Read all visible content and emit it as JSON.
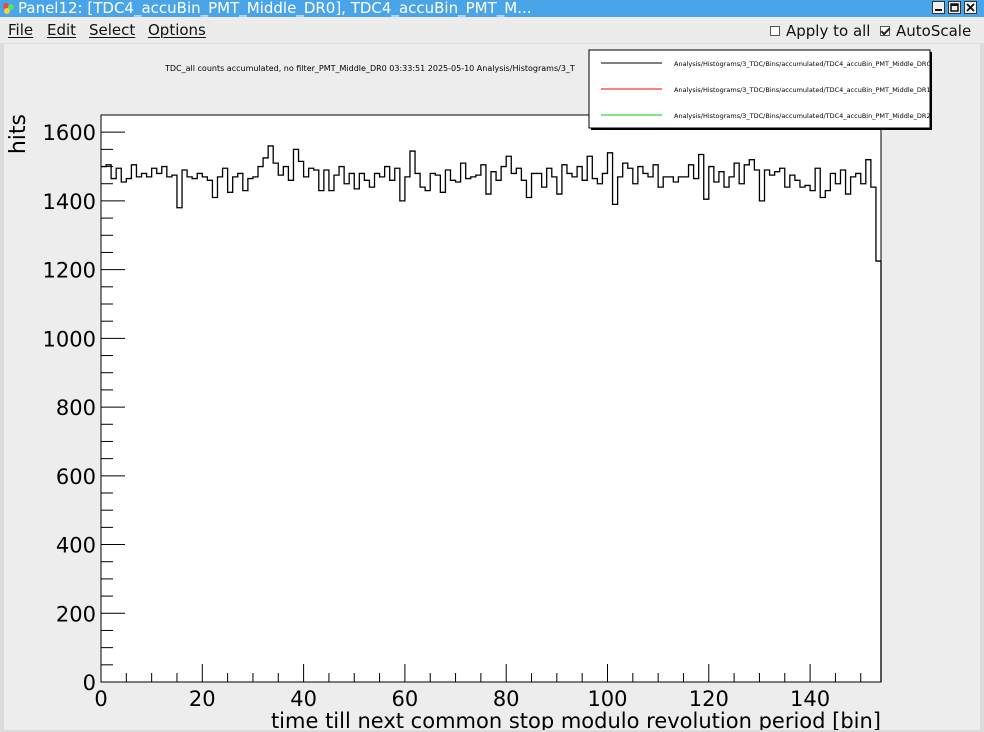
{
  "window": {
    "title": "Panel12: [TDC4_accuBin_PMT_Middle_DR0], TDC4_accuBin_PMT_M..."
  },
  "menu": {
    "file": "File",
    "edit": "Edit",
    "select": "Select",
    "options": "Options"
  },
  "controls": {
    "apply_to_all_label": "Apply to all",
    "apply_to_all_checked": false,
    "autoscale_label": "AutoScale",
    "autoscale_checked": true
  },
  "chart_data": {
    "type": "line",
    "style": "histogram-step",
    "title": "TDC_all counts accumulated, no filter_PMT_Middle_DR0  03:33:51  2025-05-10  Analysis/Histograms/3_T",
    "xlabel": "time till next common stop modulo revolution period [bin]",
    "ylabel": "hits",
    "xlim": [
      0,
      154
    ],
    "ylim": [
      0,
      1650
    ],
    "xticks": [
      0,
      20,
      40,
      60,
      80,
      100,
      120,
      140
    ],
    "yticks": [
      0,
      200,
      400,
      600,
      800,
      1000,
      1200,
      1400,
      1600
    ],
    "grid": false,
    "legend_position": "top-right",
    "series": [
      {
        "name": "Analysis/Histograms/3_TDC/Bins/accumulated/TDC4_accuBin_PMT_Middle_DR0",
        "color": "#000000",
        "bin_width": 1,
        "values": [
          1500,
          1505,
          1465,
          1495,
          1455,
          1465,
          1505,
          1470,
          1480,
          1470,
          1495,
          1480,
          1500,
          1470,
          1475,
          1380,
          1490,
          1470,
          1465,
          1480,
          1470,
          1460,
          1410,
          1470,
          1495,
          1425,
          1470,
          1480,
          1430,
          1465,
          1470,
          1500,
          1525,
          1560,
          1510,
          1475,
          1500,
          1460,
          1550,
          1515,
          1470,
          1495,
          1490,
          1430,
          1490,
          1430,
          1475,
          1500,
          1450,
          1480,
          1435,
          1480,
          1460,
          1440,
          1480,
          1470,
          1500,
          1460,
          1495,
          1400,
          1470,
          1545,
          1480,
          1440,
          1430,
          1480,
          1475,
          1425,
          1490,
          1460,
          1455,
          1510,
          1465,
          1470,
          1475,
          1505,
          1420,
          1485,
          1460,
          1500,
          1530,
          1480,
          1495,
          1460,
          1410,
          1480,
          1480,
          1440,
          1495,
          1470,
          1420,
          1505,
          1480,
          1470,
          1500,
          1460,
          1530,
          1465,
          1450,
          1480,
          1540,
          1390,
          1470,
          1510,
          1495,
          1450,
          1500,
          1480,
          1470,
          1505,
          1440,
          1470,
          1470,
          1455,
          1470,
          1470,
          1505,
          1465,
          1535,
          1405,
          1500,
          1455,
          1485,
          1440,
          1470,
          1510,
          1450,
          1505,
          1520,
          1490,
          1400,
          1490,
          1475,
          1485,
          1495,
          1440,
          1475,
          1460,
          1440,
          1445,
          1430,
          1495,
          1410,
          1430,
          1480,
          1450,
          1490,
          1420,
          1470,
          1480,
          1450,
          1520,
          1440,
          1225
        ]
      },
      {
        "name": "Analysis/Histograms/3_TDC/Bins/accumulated/TDC4_accuBin_PMT_Middle_DR1",
        "color": "#ff0000",
        "values": []
      },
      {
        "name": "Analysis/Histograms/3_TDC/Bins/accumulated/TDC4_accuBin_PMT_Middle_DR2",
        "color": "#00cc00",
        "values": []
      }
    ]
  }
}
